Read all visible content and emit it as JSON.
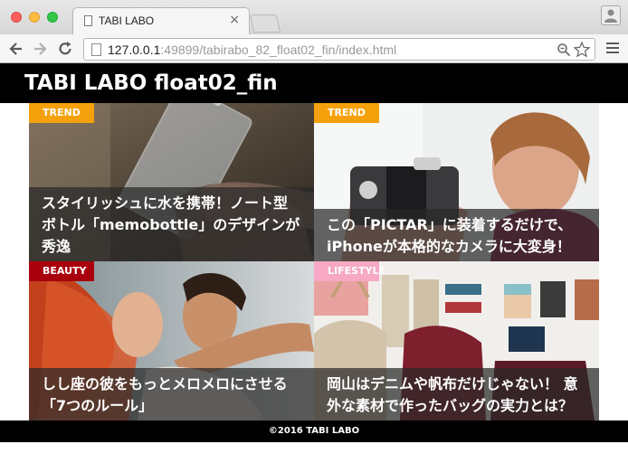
{
  "browser": {
    "tab_title": "TABI LABO",
    "tab_close": "×",
    "url_host": "127.0.0.1",
    "url_rest": ":49899/tabirabo_82_float02_fin/index.html"
  },
  "site": {
    "title": "TABI LABO float02_fin",
    "footer": "©2016 TABI LABO"
  },
  "articles": [
    {
      "category": "TREND",
      "category_color": "#f5a10c",
      "title": "スタイリッシュに水を携帯！ノート型ボトル「memobottle」のデザインが秀逸"
    },
    {
      "category": "TREND",
      "category_color": "#f5a10c",
      "title": "この「PICTAR」に装着するだけで、iPhoneが本格的なカメラに大変身！"
    },
    {
      "category": "BEAUTY",
      "category_color": "#a8000c",
      "title": "しし座の彼をもっとメロメロにさせる「7つのルール」"
    },
    {
      "category": "LIFESTYLE",
      "category_color": "#f7a8c4",
      "title": "岡山はデニムや帆布だけじゃない！ 意外な素材で作ったバッグの実力とは？"
    }
  ]
}
